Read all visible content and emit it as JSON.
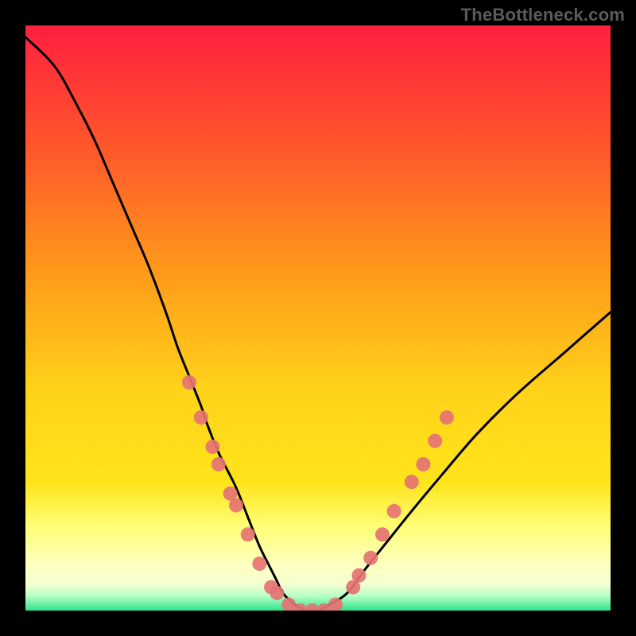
{
  "watermark": {
    "text": "TheBottleneck.com"
  },
  "chart_data": {
    "type": "line",
    "title": "",
    "xlabel": "",
    "ylabel": "",
    "xlim": [
      0,
      100
    ],
    "ylim": [
      0,
      100
    ],
    "grid": false,
    "legend": false,
    "gradient_colors": {
      "top": "#ff1f3f",
      "upper_mid": "#ff9a1a",
      "mid": "#ffe41a",
      "lower_mid": "#ffff7a",
      "bottom_band_pale": "#f6ffd2",
      "bottom_band_green": "#2fe28e",
      "black_frame": "#000000"
    },
    "series": [
      {
        "name": "bottleneck-curve",
        "color": "#000000",
        "x": [
          0,
          5,
          9,
          12,
          15,
          18,
          21,
          24,
          26,
          28,
          30,
          31,
          33,
          34,
          36,
          38,
          40,
          42,
          43,
          44,
          46,
          48,
          50,
          52,
          55,
          58,
          62,
          66,
          71,
          77,
          84,
          92,
          100
        ],
        "y": [
          98,
          93,
          86,
          80,
          73,
          66,
          59,
          51,
          45,
          40,
          35,
          32,
          27,
          25,
          21,
          16,
          11,
          7,
          5,
          3,
          1,
          0,
          0,
          1,
          3,
          7,
          12,
          17,
          23,
          30,
          37,
          44,
          51
        ]
      }
    ],
    "markers": {
      "name": "gpu-models",
      "shape": "circle",
      "color": "#e57373",
      "radius_px": 9,
      "points_xy": [
        [
          28,
          39
        ],
        [
          30,
          33
        ],
        [
          32,
          28
        ],
        [
          33,
          25
        ],
        [
          35,
          20
        ],
        [
          36,
          18
        ],
        [
          38,
          13
        ],
        [
          40,
          8
        ],
        [
          42,
          4
        ],
        [
          43,
          3
        ],
        [
          45,
          1
        ],
        [
          47,
          0
        ],
        [
          49,
          0
        ],
        [
          51,
          0
        ],
        [
          53,
          1
        ],
        [
          56,
          4
        ],
        [
          57,
          6
        ],
        [
          59,
          9
        ],
        [
          61,
          13
        ],
        [
          63,
          17
        ],
        [
          66,
          22
        ],
        [
          68,
          25
        ],
        [
          70,
          29
        ],
        [
          72,
          33
        ]
      ]
    }
  }
}
